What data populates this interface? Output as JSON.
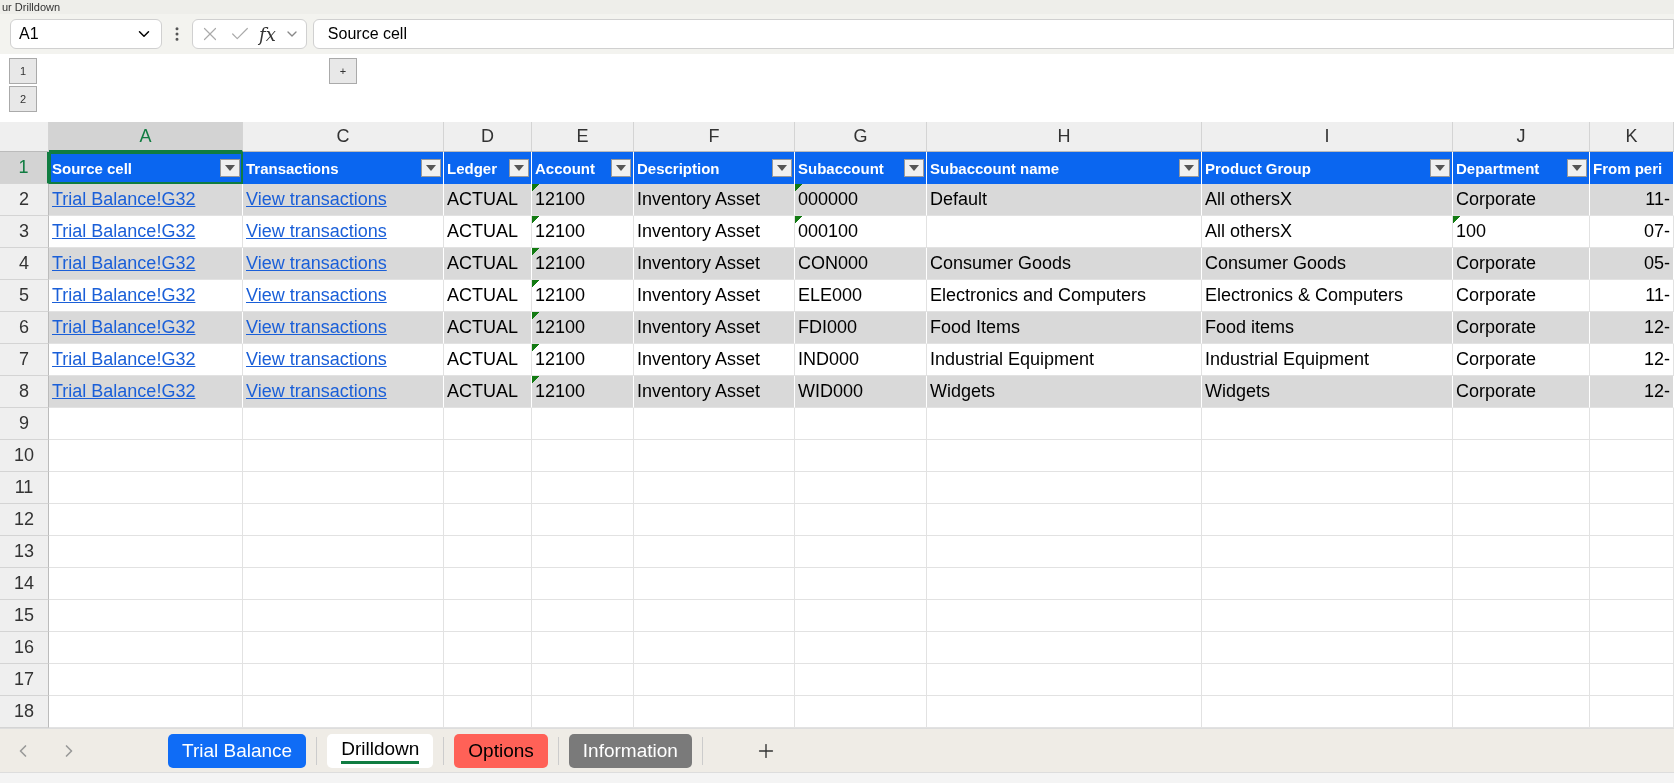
{
  "window": {
    "title": "ur Drilldown"
  },
  "formula_bar": {
    "name_box": "A1",
    "function_button": "fx",
    "formula": "Source cell"
  },
  "outline": {
    "levels": [
      "1",
      "2"
    ],
    "expand": "+"
  },
  "columns": [
    {
      "letter": "A",
      "selected": true,
      "header": "Source cell",
      "filter": true,
      "kind": "link"
    },
    {
      "letter": "C",
      "selected": false,
      "header": "Transactions",
      "filter": true,
      "kind": "link"
    },
    {
      "letter": "D",
      "selected": false,
      "header": "Ledger",
      "filter": true,
      "kind": "text"
    },
    {
      "letter": "E",
      "selected": false,
      "header": "Account",
      "filter": true,
      "kind": "text"
    },
    {
      "letter": "F",
      "selected": false,
      "header": "Description",
      "filter": true,
      "kind": "text"
    },
    {
      "letter": "G",
      "selected": false,
      "header": "Subaccount",
      "filter": true,
      "kind": "text"
    },
    {
      "letter": "H",
      "selected": false,
      "header": "Subaccount name",
      "filter": true,
      "kind": "text"
    },
    {
      "letter": "I",
      "selected": false,
      "header": "Product Group",
      "filter": true,
      "kind": "text"
    },
    {
      "letter": "J",
      "selected": false,
      "header": "Department",
      "filter": true,
      "kind": "text"
    },
    {
      "letter": "K",
      "selected": false,
      "header": "From peri",
      "filter": false,
      "kind": "date"
    }
  ],
  "row_numbers": [
    {
      "label": "1",
      "selected": true
    },
    {
      "label": "2",
      "selected": false
    },
    {
      "label": "3",
      "selected": false
    },
    {
      "label": "4",
      "selected": false
    },
    {
      "label": "5",
      "selected": false
    },
    {
      "label": "6",
      "selected": false
    },
    {
      "label": "7",
      "selected": false
    },
    {
      "label": "8",
      "selected": false
    },
    {
      "label": "9",
      "selected": false
    },
    {
      "label": "10",
      "selected": false
    },
    {
      "label": "11",
      "selected": false
    },
    {
      "label": "12",
      "selected": false
    },
    {
      "label": "13",
      "selected": false
    },
    {
      "label": "14",
      "selected": false
    },
    {
      "label": "15",
      "selected": false
    },
    {
      "label": "16",
      "selected": false
    },
    {
      "label": "17",
      "selected": false
    },
    {
      "label": "18",
      "selected": false
    }
  ],
  "records": [
    {
      "cells": [
        {
          "text": "Trial Balance!G32",
          "flag": false
        },
        {
          "text": "View transactions",
          "flag": false
        },
        {
          "text": "ACTUAL",
          "flag": false
        },
        {
          "text": "12100",
          "flag": true
        },
        {
          "text": "Inventory Asset",
          "flag": false
        },
        {
          "text": "000000",
          "flag": true
        },
        {
          "text": "Default",
          "flag": false
        },
        {
          "text": "All othersX",
          "flag": false
        },
        {
          "text": "Corporate",
          "flag": false
        },
        {
          "text": "11-",
          "flag": false
        }
      ]
    },
    {
      "cells": [
        {
          "text": "Trial Balance!G32",
          "flag": false
        },
        {
          "text": "View transactions",
          "flag": false
        },
        {
          "text": "ACTUAL",
          "flag": false
        },
        {
          "text": "12100",
          "flag": true
        },
        {
          "text": "Inventory Asset",
          "flag": false
        },
        {
          "text": "000100",
          "flag": true
        },
        {
          "flag": false
        },
        {
          "text": "All othersX",
          "flag": false
        },
        {
          "text": "100",
          "flag": true
        },
        {
          "text": "07-",
          "flag": false
        }
      ]
    },
    {
      "cells": [
        {
          "text": "Trial Balance!G32",
          "flag": false
        },
        {
          "text": "View transactions",
          "flag": false
        },
        {
          "text": "ACTUAL",
          "flag": false
        },
        {
          "text": "12100",
          "flag": true
        },
        {
          "text": "Inventory Asset",
          "flag": false
        },
        {
          "text": "CON000",
          "flag": false
        },
        {
          "text": "Consumer Goods",
          "flag": false
        },
        {
          "text": "Consumer Goods",
          "flag": false
        },
        {
          "text": "Corporate",
          "flag": false
        },
        {
          "text": "05-",
          "flag": false
        }
      ]
    },
    {
      "cells": [
        {
          "text": "Trial Balance!G32",
          "flag": false
        },
        {
          "text": "View transactions",
          "flag": false
        },
        {
          "text": "ACTUAL",
          "flag": false
        },
        {
          "text": "12100",
          "flag": true
        },
        {
          "text": "Inventory Asset",
          "flag": false
        },
        {
          "text": "ELE000",
          "flag": false
        },
        {
          "text": "Electronics and Computers",
          "flag": false
        },
        {
          "text": "Electronics & Computers",
          "flag": false
        },
        {
          "text": "Corporate",
          "flag": false
        },
        {
          "text": "11-",
          "flag": false
        }
      ]
    },
    {
      "cells": [
        {
          "text": "Trial Balance!G32",
          "flag": false
        },
        {
          "text": "View transactions",
          "flag": false
        },
        {
          "text": "ACTUAL",
          "flag": false
        },
        {
          "text": "12100",
          "flag": true
        },
        {
          "text": "Inventory Asset",
          "flag": false
        },
        {
          "text": "FDI000",
          "flag": false
        },
        {
          "text": "Food Items",
          "flag": false
        },
        {
          "text": "Food items",
          "flag": false
        },
        {
          "text": "Corporate",
          "flag": false
        },
        {
          "text": "12-",
          "flag": false
        }
      ]
    },
    {
      "cells": [
        {
          "text": "Trial Balance!G32",
          "flag": false
        },
        {
          "text": "View transactions",
          "flag": false
        },
        {
          "text": "ACTUAL",
          "flag": false
        },
        {
          "text": "12100",
          "flag": true
        },
        {
          "text": "Inventory Asset",
          "flag": false
        },
        {
          "text": "IND000",
          "flag": false
        },
        {
          "text": "Industrial Equipment",
          "flag": false
        },
        {
          "text": "Industrial Equipment",
          "flag": false
        },
        {
          "text": "Corporate",
          "flag": false
        },
        {
          "text": "12-",
          "flag": false
        }
      ]
    },
    {
      "cells": [
        {
          "text": "Trial Balance!G32",
          "flag": false
        },
        {
          "text": "View transactions",
          "flag": false
        },
        {
          "text": "ACTUAL",
          "flag": false
        },
        {
          "text": "12100",
          "flag": true
        },
        {
          "text": "Inventory Asset",
          "flag": false
        },
        {
          "text": "WID000",
          "flag": false
        },
        {
          "text": "Widgets",
          "flag": false
        },
        {
          "text": "Widgets",
          "flag": false
        },
        {
          "text": "Corporate",
          "flag": false
        },
        {
          "text": "12-",
          "flag": false
        }
      ]
    }
  ],
  "sheet_tabs": [
    {
      "label": "Trial Balance",
      "selected": false,
      "color": "#0f6cf6"
    },
    {
      "label": "Drilldown",
      "selected": true,
      "color": "#ffffff"
    },
    {
      "label": "Options",
      "selected": false,
      "color": "#ff6157"
    },
    {
      "label": "Information",
      "selected": false,
      "color": "#7a7a7a"
    }
  ]
}
